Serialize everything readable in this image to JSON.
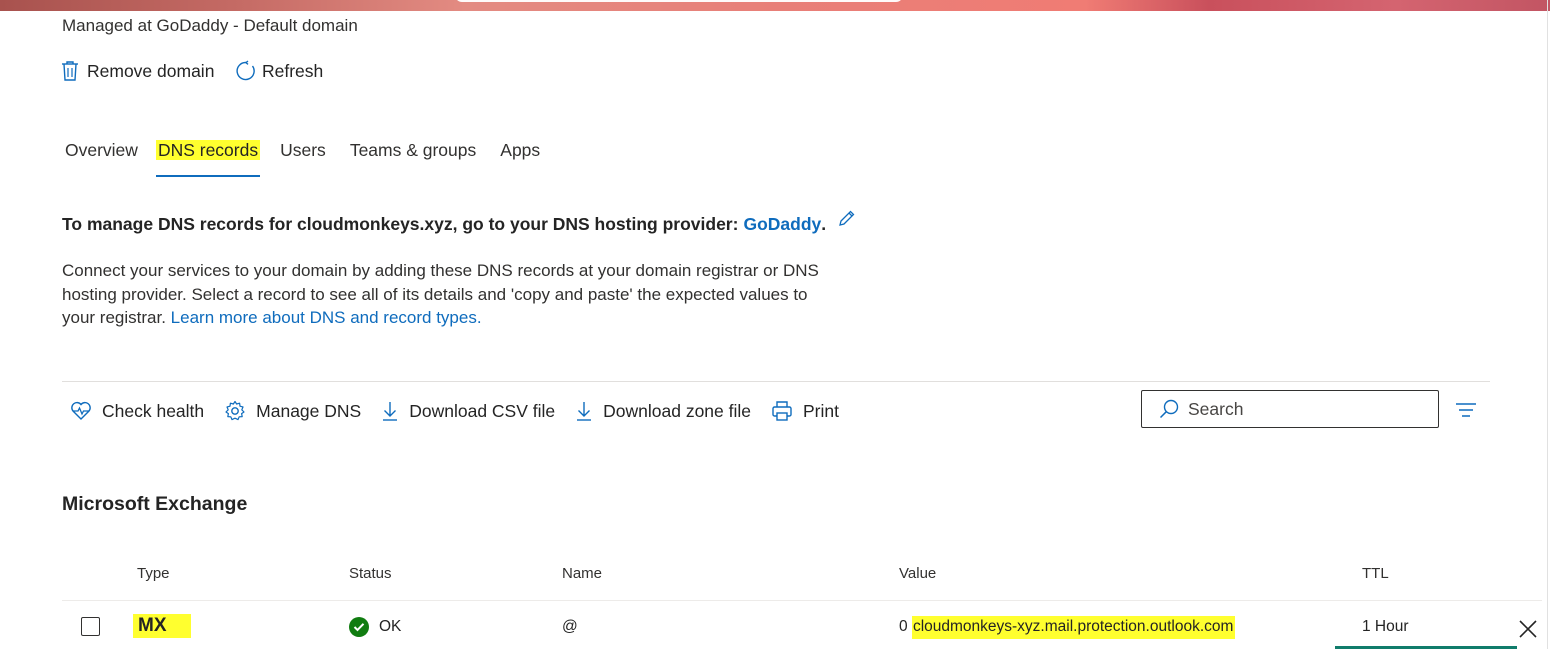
{
  "header": {
    "subtitle": "Managed at GoDaddy - Default domain",
    "remove_label": "Remove domain",
    "refresh_label": "Refresh"
  },
  "tabs": [
    {
      "label": "Overview",
      "active": false
    },
    {
      "label": "DNS records",
      "active": true
    },
    {
      "label": "Users",
      "active": false
    },
    {
      "label": "Teams & groups",
      "active": false
    },
    {
      "label": "Apps",
      "active": false
    }
  ],
  "dns_notice": {
    "text": "To manage DNS records for cloudmonkeys.xyz, go to your DNS hosting provider:",
    "provider": "GoDaddy",
    "period": "."
  },
  "description": {
    "text": "Connect your services to your domain by adding these DNS records at your domain registrar or DNS hosting provider. Select a record to see all of its details and 'copy and paste' the expected values to your registrar.",
    "link": "Learn more about DNS and record types."
  },
  "toolbar": {
    "check_health": "Check health",
    "manage_dns": "Manage DNS",
    "download_csv": "Download CSV file",
    "download_zone": "Download zone file",
    "print": "Print"
  },
  "search": {
    "placeholder": "Search",
    "value": ""
  },
  "section_title": "Microsoft Exchange",
  "table": {
    "columns": [
      "Type",
      "Status",
      "Name",
      "Value",
      "TTL"
    ],
    "rows": [
      {
        "type": "MX",
        "status": "OK",
        "name": "@",
        "value_prefix": "0",
        "value": "cloudmonkeys-xyz.mail.protection.outlook.com",
        "ttl": "1 Hour"
      }
    ]
  },
  "colors": {
    "highlight": "#ffff2f",
    "link": "#0f6cbd",
    "tab_underline": "#0f6cbd",
    "ok_green": "#107c10",
    "icon_blue": "#0f6cbd"
  },
  "icons": [
    "trash-icon",
    "refresh-icon",
    "pencil-icon",
    "heart-pulse-icon",
    "gear-icon",
    "download-icon",
    "print-icon",
    "search-icon",
    "filter-icon",
    "check-icon",
    "close-icon"
  ]
}
